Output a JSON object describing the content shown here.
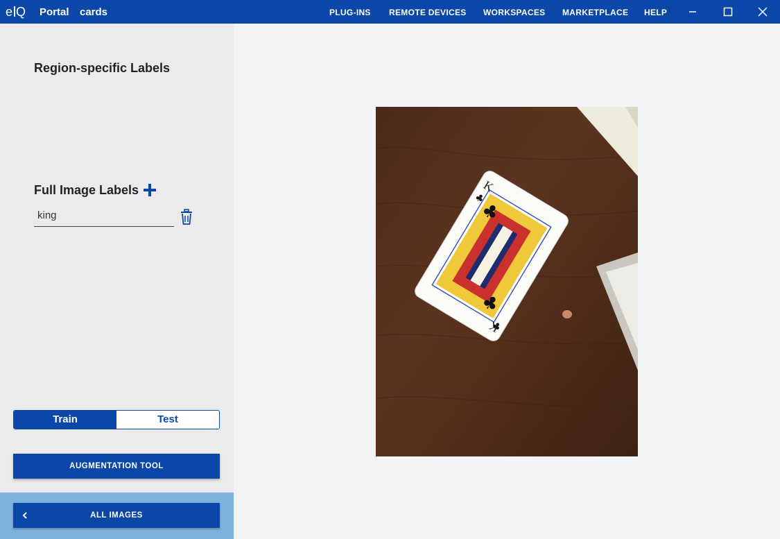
{
  "header": {
    "logo_text": "eIQ",
    "app_title": "Portal",
    "project_name": "cards",
    "nav": [
      "PLUG-INS",
      "REMOTE DEVICES",
      "WORKSPACES",
      "MARKETPLACE",
      "HELP"
    ]
  },
  "sidebar": {
    "region_labels_title": "Region-specific Labels",
    "full_labels_title": "Full Image Labels",
    "labels": [
      {
        "value": "king"
      }
    ],
    "toggle": {
      "train": "Train",
      "test": "Test",
      "selected": "Train"
    },
    "augmentation_button": "AUGMENTATION TOOL",
    "all_images_button": "ALL IMAGES"
  },
  "colors": {
    "brand_blue": "#0a47a8",
    "footer_blue": "#7fb2dd",
    "sidebar_bg": "#ebebeb",
    "main_bg": "#f3f4f6"
  },
  "image": {
    "subject": "King of clubs playing card on wooden table"
  }
}
